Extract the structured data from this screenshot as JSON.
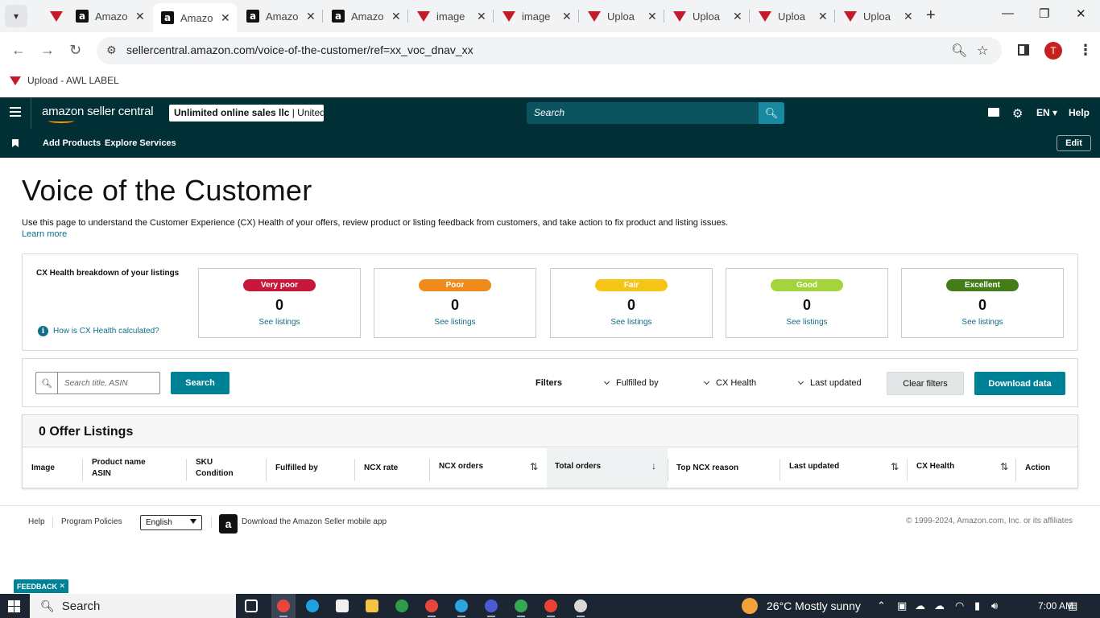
{
  "browser": {
    "tabs": [
      {
        "label": "Amazo",
        "icon": "amazon-favicon",
        "active": false
      },
      {
        "label": "Amazo",
        "icon": "amazon-favicon",
        "active": true
      },
      {
        "label": "Amazo",
        "icon": "amazon-favicon",
        "active": false
      },
      {
        "label": "Amazo",
        "icon": "amazon-favicon",
        "active": false
      },
      {
        "label": "image",
        "icon": "awl-favicon",
        "active": false
      },
      {
        "label": "image",
        "icon": "awl-favicon",
        "active": false
      },
      {
        "label": "Uploa",
        "icon": "awl-favicon",
        "active": false
      },
      {
        "label": "Uploa",
        "icon": "awl-favicon",
        "active": false
      },
      {
        "label": "Uploa",
        "icon": "awl-favicon",
        "active": false
      },
      {
        "label": "Uploa",
        "icon": "awl-favicon",
        "active": false
      }
    ],
    "url": "sellercentral.amazon.com/voice-of-the-customer/ref=xx_voc_dnav_xx",
    "profile_initial": "T",
    "bookmark": {
      "label": "Upload - AWL LABEL"
    }
  },
  "header": {
    "logo_text": "amazon seller central",
    "account_name": "Unlimited online sales llc",
    "account_region": "United...",
    "search_placeholder": "Search",
    "language": "EN",
    "help_label": "Help"
  },
  "subnav": {
    "links": [
      "Add Products",
      "Explore Services"
    ],
    "edit_label": "Edit"
  },
  "page": {
    "title": "Voice of the Customer",
    "intro": "Use this page to understand the Customer Experience (CX) Health of your offers, review product or listing feedback from customers, and take action to fix product and listing issues.",
    "learn_more": "Learn more"
  },
  "cx_health": {
    "heading": "CX Health breakdown of your listings",
    "how_link": "How is CX Health calculated?",
    "cards": [
      {
        "label": "Very poor",
        "count": "0",
        "link": "See listings",
        "color": "#c7183b"
      },
      {
        "label": "Poor",
        "count": "0",
        "link": "See listings",
        "color": "#f08b1b"
      },
      {
        "label": "Fair",
        "count": "0",
        "link": "See listings",
        "color": "#f5c518"
      },
      {
        "label": "Good",
        "count": "0",
        "link": "See listings",
        "color": "#a4d43b"
      },
      {
        "label": "Excellent",
        "count": "0",
        "link": "See listings",
        "color": "#427d18"
      }
    ]
  },
  "filters": {
    "search_placeholder": "Search title, ASIN",
    "search_button": "Search",
    "label": "Filters",
    "dropdowns": [
      "Fulfilled by",
      "CX Health",
      "Last updated"
    ],
    "clear_button": "Clear filters",
    "download_button": "Download data"
  },
  "listings": {
    "title": "0 Offer Listings",
    "columns": {
      "image": "Image",
      "product_name": "Product name",
      "asin": "ASIN",
      "sku": "SKU",
      "condition": "Condition",
      "fulfilled_by": "Fulfilled by",
      "ncx_rate": "NCX rate",
      "ncx_orders": "NCX orders",
      "total_orders": "Total orders",
      "top_ncx_reason": "Top NCX reason",
      "last_updated": "Last updated",
      "cx_health": "CX Health",
      "action": "Action"
    }
  },
  "footer": {
    "help": "Help",
    "program_policies": "Program Policies",
    "language_selected": "English",
    "app_download": "Download the Amazon Seller mobile app",
    "copyright": "© 1999-2024, Amazon.com, Inc. or its affiliates",
    "feedback": "FEEDBACK"
  },
  "taskbar": {
    "search": "Search",
    "weather": "26°C  Mostly sunny",
    "time": "7:00 AM"
  },
  "colors": {
    "header_bg": "#002f36",
    "primary_button": "#008296",
    "link": "#0f6f88"
  }
}
